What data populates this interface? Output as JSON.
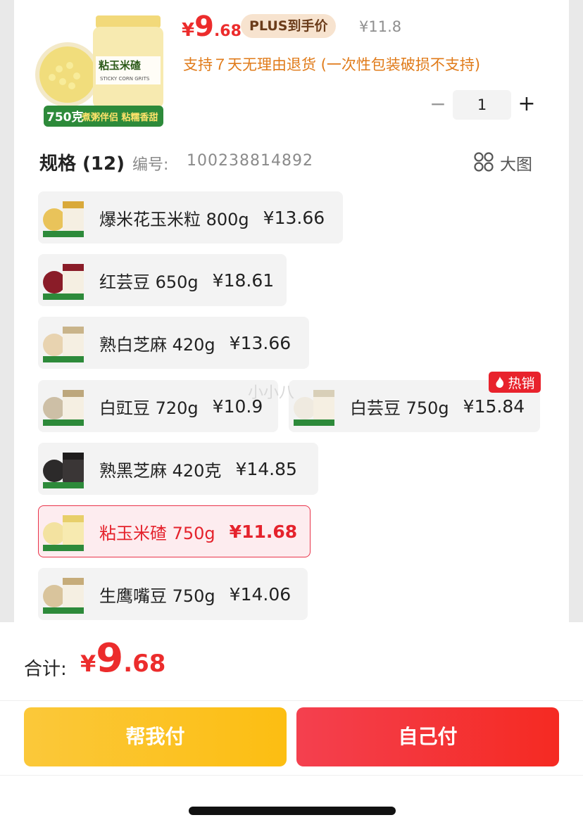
{
  "product": {
    "price_symbol": "¥",
    "price_int": "9",
    "price_dec": ".68",
    "plus_badge": "PLUS到手价",
    "original_price": "¥11.8",
    "return_policy": "支持７天无理由退货 (一次性包装破损不支持)",
    "quantity": "1",
    "stepper_minus": "−",
    "stepper_plus": "+",
    "image_caption_weight": "750克",
    "image_caption_text": "煮粥伴侣 粘糯香甜",
    "image_jar_label": "粘玉米碴"
  },
  "spec": {
    "title": "规格 (12)",
    "code_label": "编号:",
    "code": "100238814892",
    "bigview_label": "大图"
  },
  "options": [
    {
      "name": "爆米花玉米粒 800g",
      "price": "¥13.66",
      "selected": false,
      "thumb_color": "#e9c35a"
    },
    {
      "name": "红芸豆 650g",
      "price": "¥18.61",
      "selected": false,
      "thumb_color": "#8a1c28"
    },
    {
      "name": "熟白芝麻 420g",
      "price": "¥13.66",
      "selected": false,
      "thumb_color": "#e8d3b0"
    },
    {
      "name": "白豇豆 720g",
      "price": "¥10.9",
      "selected": false,
      "thumb_color": "#cdbfa6"
    },
    {
      "name": "白芸豆 750g",
      "price": "¥15.84",
      "selected": false,
      "thumb_color": "#efeae0"
    },
    {
      "name": "熟黑芝麻 420克",
      "price": "¥14.85",
      "selected": false,
      "thumb_color": "#2c2a2a"
    },
    {
      "name": "粘玉米碴 750g",
      "price": "¥11.68",
      "selected": true,
      "thumb_color": "#f3e2a0"
    },
    {
      "name": "生鹰嘴豆 750g",
      "price": "¥14.06",
      "selected": false,
      "thumb_color": "#d9c49c"
    }
  ],
  "hot_badge": "热销",
  "watermark": "小小八",
  "footer": {
    "total_label": "合计:",
    "total_symbol": "¥",
    "total_int": "9",
    "total_dec": ".68",
    "help_pay": "帮我付",
    "self_pay": "自己付"
  },
  "colors": {
    "accent_red": "#e5222c",
    "orange": "#e07b1a",
    "yellow_button": "#fcbe12"
  }
}
